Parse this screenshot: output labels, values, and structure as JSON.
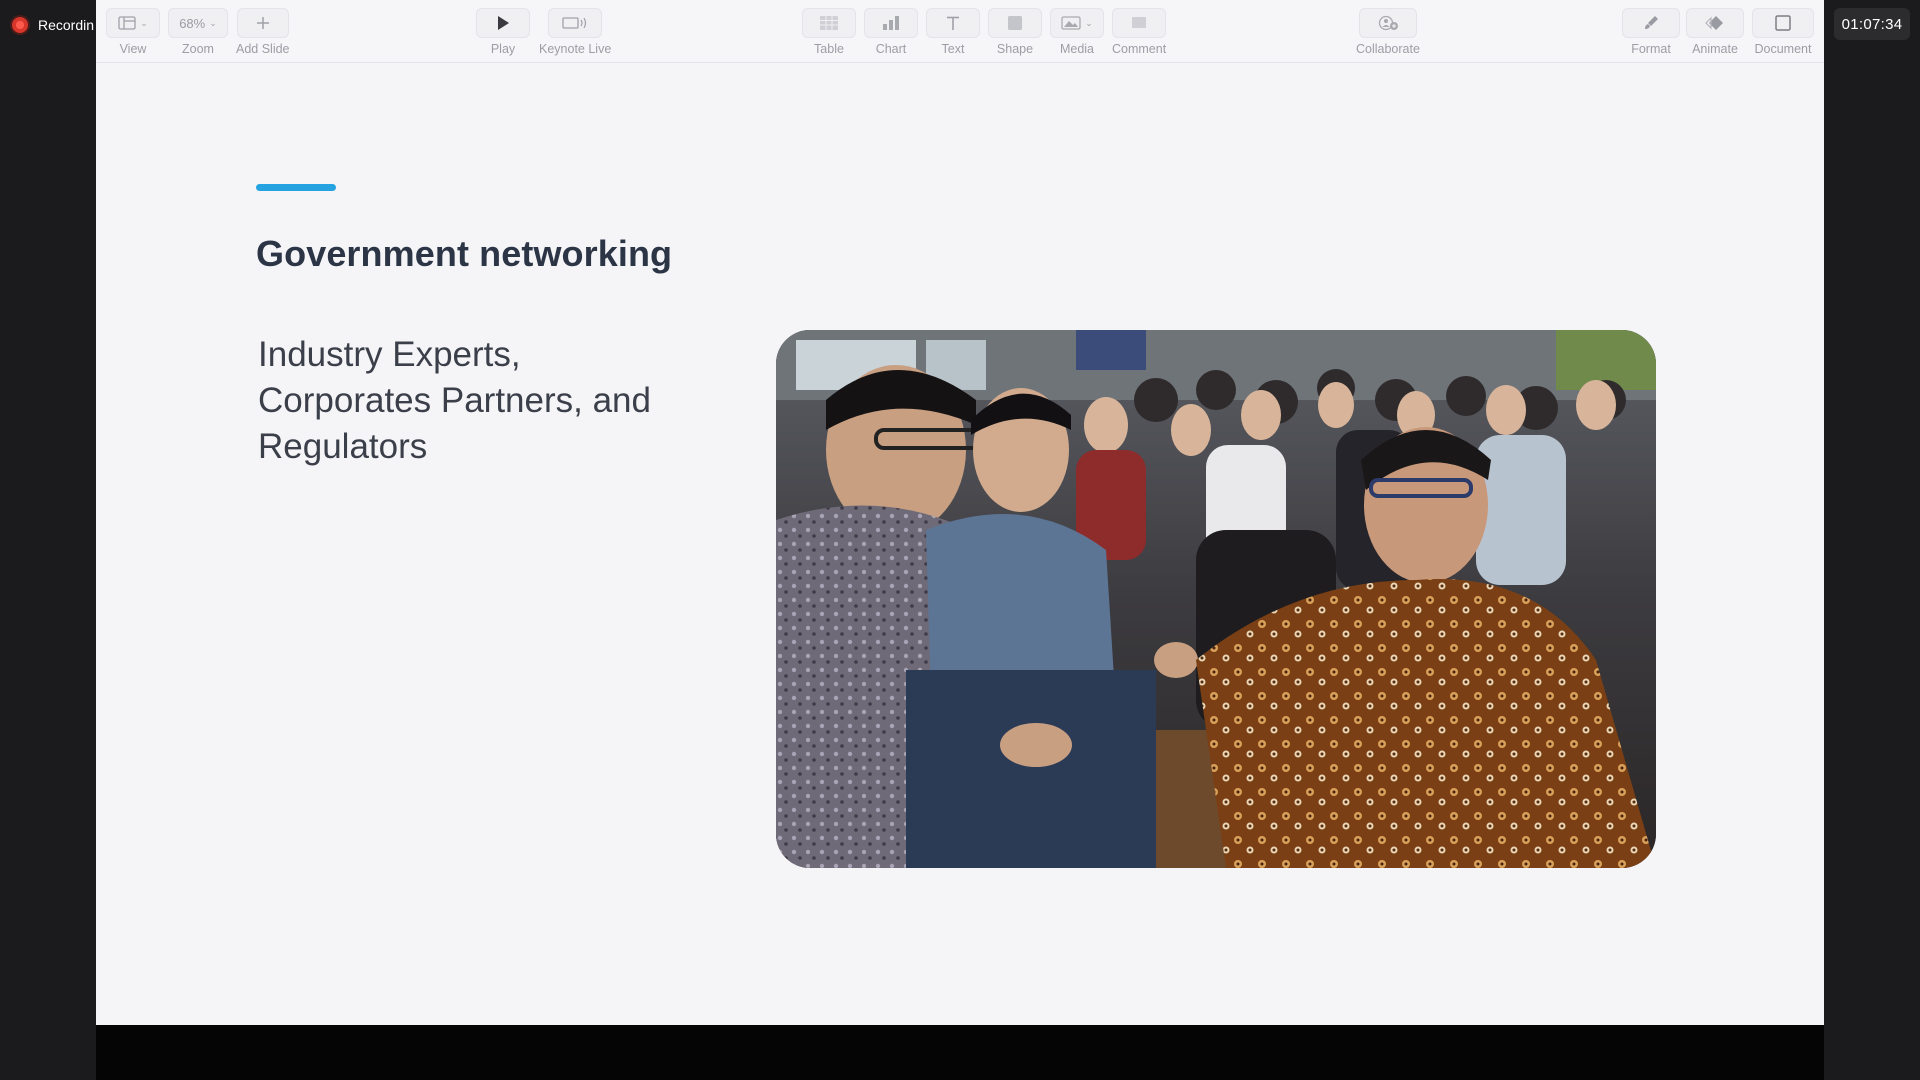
{
  "recording": {
    "label": "Recordin"
  },
  "timer": {
    "text": "01:07:34"
  },
  "toolbar": {
    "view": {
      "label": "View"
    },
    "zoom": {
      "value": "68%",
      "label": "Zoom"
    },
    "add_slide": {
      "label": "Add Slide"
    },
    "play": {
      "label": "Play"
    },
    "keynote_live": {
      "label": "Keynote Live"
    },
    "table": {
      "label": "Table"
    },
    "chart": {
      "label": "Chart"
    },
    "text": {
      "label": "Text"
    },
    "shape": {
      "label": "Shape"
    },
    "media": {
      "label": "Media"
    },
    "comment": {
      "label": "Comment"
    },
    "collaborate": {
      "label": "Collaborate"
    },
    "format": {
      "label": "Format"
    },
    "animate": {
      "label": "Animate"
    },
    "document": {
      "label": "Document"
    }
  },
  "slide": {
    "title": "Government networking",
    "body_lines": [
      "Industry Experts,",
      "Corporates Partners, and",
      "Regulators"
    ],
    "accent_color": "#24a3e0"
  }
}
